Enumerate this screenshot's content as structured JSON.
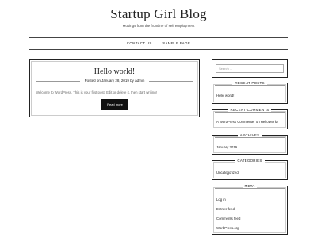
{
  "site": {
    "title": "Startup Girl Blog",
    "description": "Musings from the frontline of self employment"
  },
  "nav": {
    "items": [
      "CONTACT US",
      "SAMPLE PAGE"
    ]
  },
  "post": {
    "title": "Hello world!",
    "meta": "Posted on January 28, 2019 by admin",
    "excerpt": "Welcome to WordPress. This is your first post. Edit or delete it, then start writing!",
    "read_more": "Read more"
  },
  "sidebar": {
    "search_placeholder": "Search ...",
    "recent_posts": {
      "title": "RECENT POSTS",
      "items": [
        "Hello world!"
      ]
    },
    "recent_comments": {
      "title": "RECENT COMMENTS",
      "text": "A WordPress Commenter on Hello world!"
    },
    "archives": {
      "title": "ARCHIVES",
      "items": [
        "January 2019"
      ]
    },
    "categories": {
      "title": "CATEGORIES",
      "items": [
        "Uncategorized"
      ]
    },
    "meta": {
      "title": "META",
      "items": [
        "Log in",
        "Entries feed",
        "Comments feed",
        "WordPress.org"
      ]
    }
  }
}
